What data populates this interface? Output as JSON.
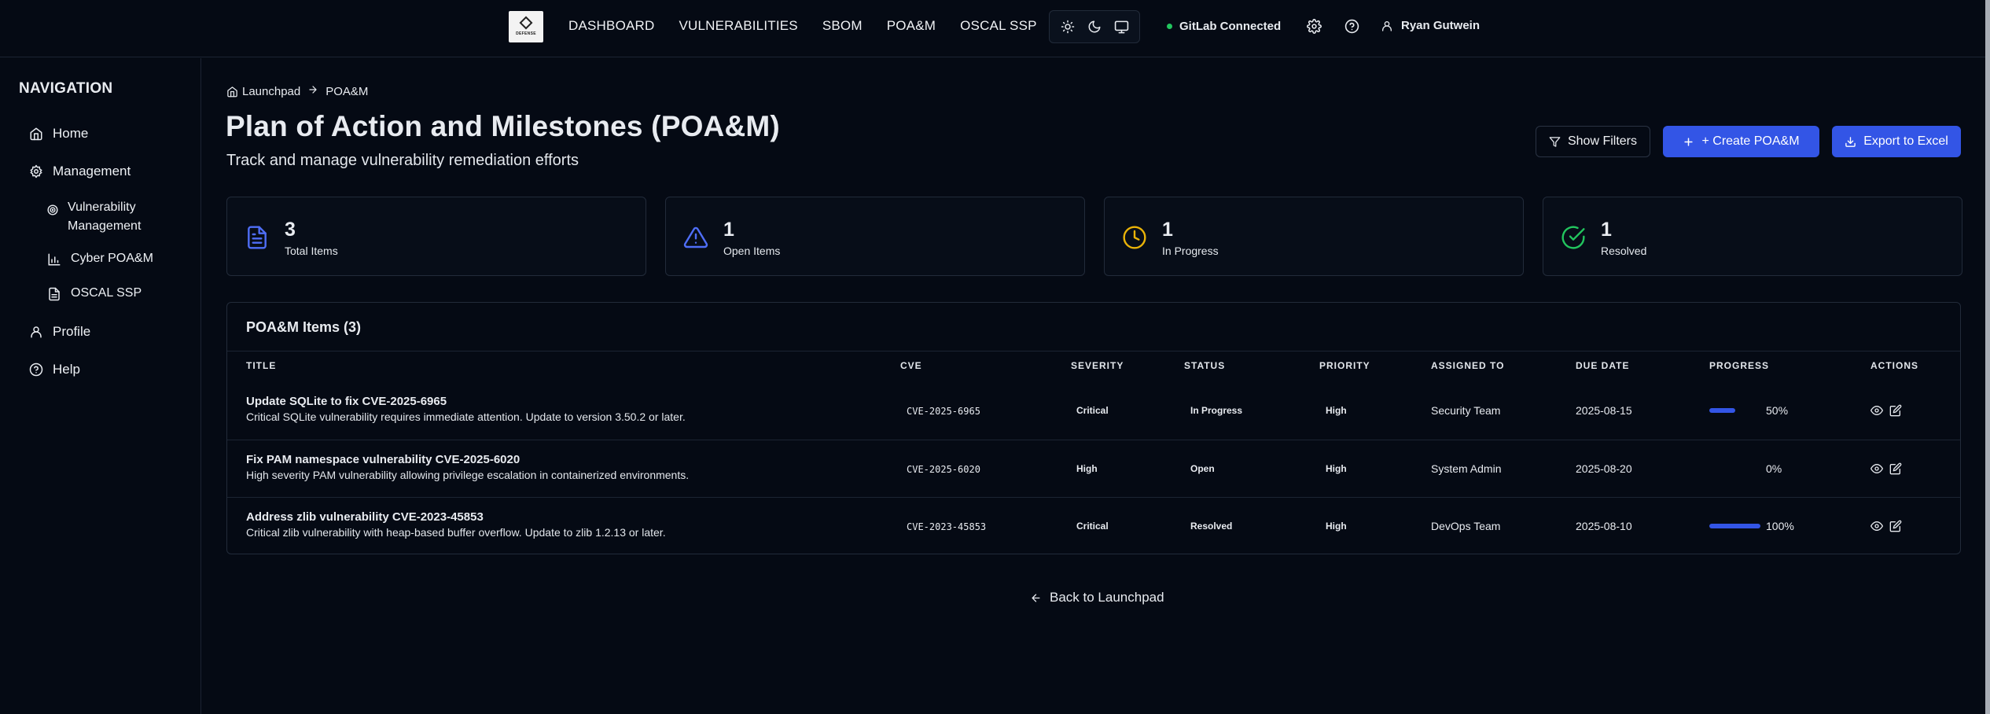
{
  "header": {
    "logo_text": "DEFENSE",
    "nav": [
      "DASHBOARD",
      "VULNERABILITIES",
      "SBOM",
      "POA&M",
      "OSCAL SSP"
    ],
    "gitlab_status": "GitLab Connected",
    "user_name": "Ryan Gutwein"
  },
  "sidebar": {
    "title": "NAVIGATION",
    "items": {
      "home": "Home",
      "management": "Management",
      "vuln_line1": "Vulnerability",
      "vuln_line2": "Management",
      "cyber_poam": "Cyber POA&M",
      "oscal_ssp": "OSCAL SSP",
      "profile": "Profile",
      "help": "Help"
    }
  },
  "breadcrumb": {
    "root": "Launchpad",
    "current": "POA&M"
  },
  "page": {
    "title": "Plan of Action and Milestones (POA&M)",
    "subtitle": "Track and manage vulnerability remediation efforts",
    "show_filters": "Show Filters",
    "create": "+ Create POA&M",
    "export": "Export to Excel"
  },
  "stats": [
    {
      "value": "3",
      "label": "Total Items",
      "color": "#4f6ef7"
    },
    {
      "value": "1",
      "label": "Open Items",
      "color": "#4f6ef7"
    },
    {
      "value": "1",
      "label": "In Progress",
      "color": "#eab308"
    },
    {
      "value": "1",
      "label": "Resolved",
      "color": "#22c55e"
    }
  ],
  "table": {
    "title": "POA&M Items (3)",
    "columns": [
      "TITLE",
      "CVE",
      "SEVERITY",
      "STATUS",
      "PRIORITY",
      "ASSIGNED TO",
      "DUE DATE",
      "PROGRESS",
      "ACTIONS"
    ],
    "rows": [
      {
        "title": "Update SQLite to fix CVE-2025-6965",
        "desc": "Critical SQLite vulnerability requires immediate attention. Update to version 3.50.2 or later.",
        "cve": "CVE-2025-6965",
        "severity": "Critical",
        "status": "In Progress",
        "priority": "High",
        "assigned": "Security Team",
        "due": "2025-08-15",
        "progress": 50,
        "progress_label": "50%"
      },
      {
        "title": "Fix PAM namespace vulnerability CVE-2025-6020",
        "desc": "High severity PAM vulnerability allowing privilege escalation in containerized environments.",
        "cve": "CVE-2025-6020",
        "severity": "High",
        "status": "Open",
        "priority": "High",
        "assigned": "System Admin",
        "due": "2025-08-20",
        "progress": 0,
        "progress_label": "0%"
      },
      {
        "title": "Address zlib vulnerability CVE-2023-45853",
        "desc": "Critical zlib vulnerability with heap-based buffer overflow. Update to zlib 1.2.13 or later.",
        "cve": "CVE-2023-45853",
        "severity": "Critical",
        "status": "Resolved",
        "priority": "High",
        "assigned": "DevOps Team",
        "due": "2025-08-10",
        "progress": 100,
        "progress_label": "100%"
      }
    ]
  },
  "back_link": "Back to Launchpad"
}
